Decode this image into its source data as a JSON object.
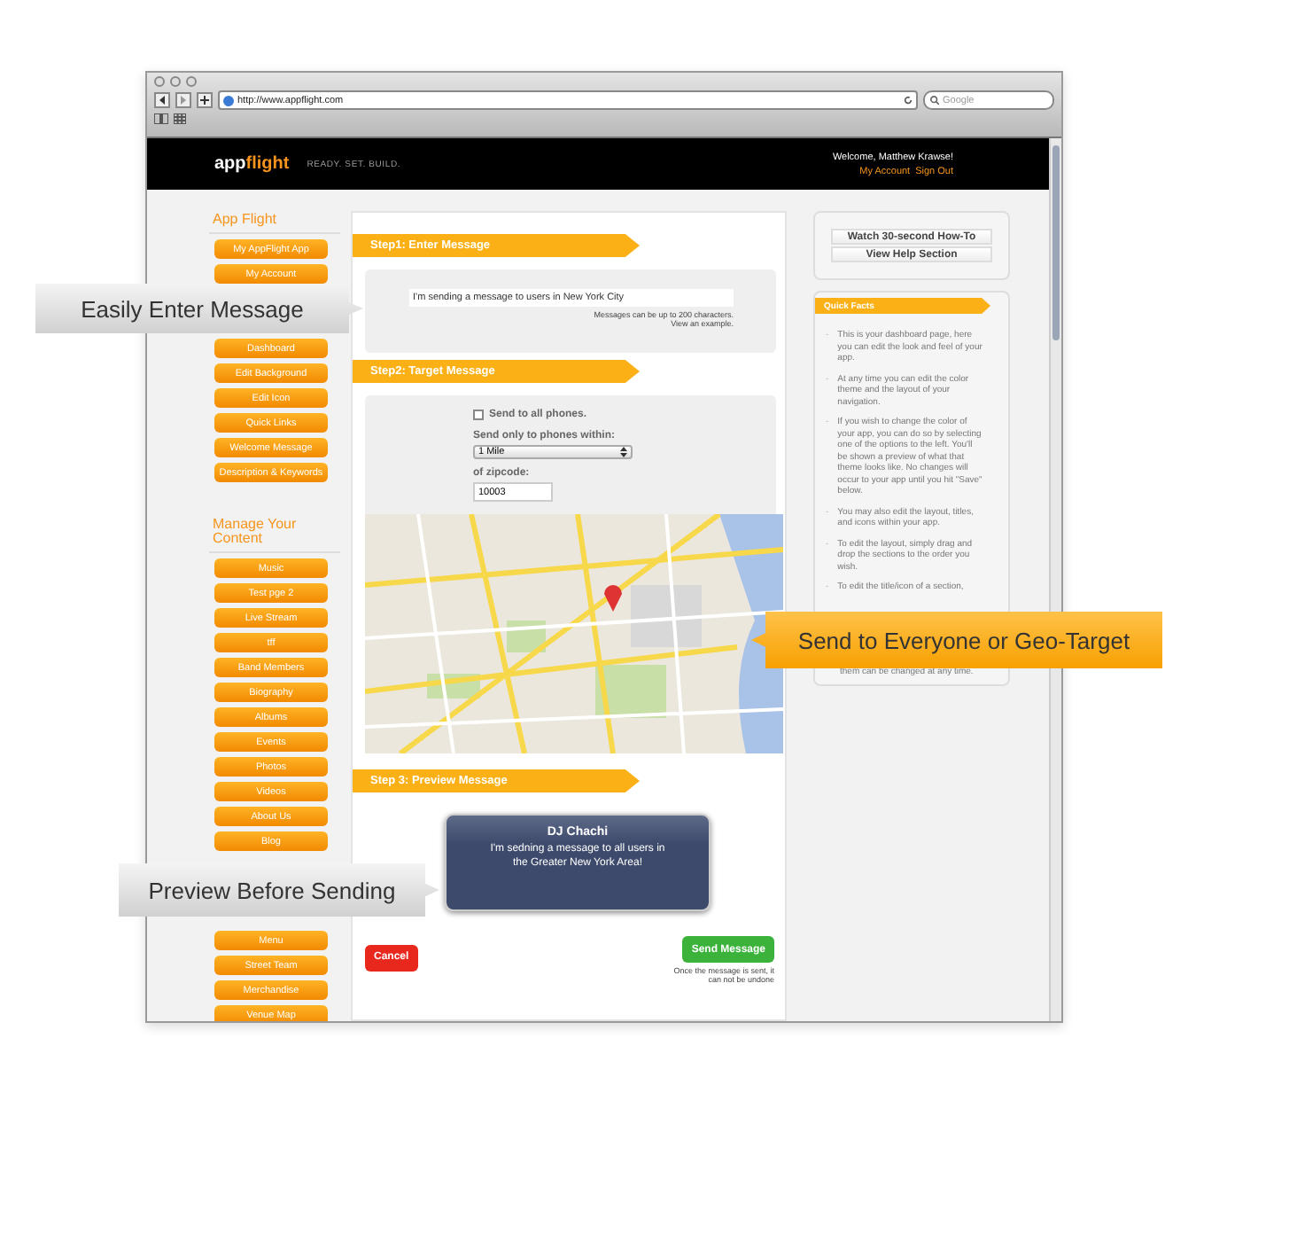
{
  "browser": {
    "url": "http://www.appflight.com",
    "search_placeholder": "Google"
  },
  "header": {
    "logo": [
      {
        "text": "app",
        "kind": "plain"
      },
      {
        "text": "flight",
        "kind": "accent"
      }
    ],
    "tagline": "READY. SET. BUILD.",
    "welcome": "Welcome, Matthew Krawse!",
    "links": [
      "My Account",
      "Sign Out"
    ]
  },
  "sidebar": {
    "sections": [
      {
        "title": "App Flight",
        "items": [
          {
            "kind": "button",
            "label": "My AppFlight App"
          },
          {
            "kind": "button",
            "label": "My Account"
          },
          {
            "kind": "gap"
          },
          {
            "kind": "gap"
          },
          {
            "kind": "button",
            "label": "Dashboard"
          },
          {
            "kind": "button",
            "label": "Edit Background"
          },
          {
            "kind": "button",
            "label": "Edit Icon"
          },
          {
            "kind": "button",
            "label": "Quick Links"
          },
          {
            "kind": "button",
            "label": "Welcome Message"
          },
          {
            "kind": "button",
            "label": "Description & Keywords"
          }
        ]
      },
      {
        "title": "Manage Your Content",
        "items": [
          {
            "kind": "button",
            "label": "Music"
          },
          {
            "kind": "button",
            "label": "Test pge 2"
          },
          {
            "kind": "button",
            "label": "Live Stream"
          },
          {
            "kind": "button",
            "label": "tff"
          },
          {
            "kind": "button",
            "label": "Band Members"
          },
          {
            "kind": "button",
            "label": "Biography"
          },
          {
            "kind": "button",
            "label": "Albums"
          },
          {
            "kind": "button",
            "label": "Events"
          },
          {
            "kind": "button",
            "label": "Photos"
          },
          {
            "kind": "button",
            "label": "Videos"
          },
          {
            "kind": "button",
            "label": "About Us"
          },
          {
            "kind": "button",
            "label": "Blog"
          },
          {
            "kind": "gap"
          },
          {
            "kind": "gap"
          },
          {
            "kind": "gap"
          },
          {
            "kind": "button",
            "label": "Menu"
          },
          {
            "kind": "button",
            "label": "Street Team"
          },
          {
            "kind": "button",
            "label": "Merchandise"
          },
          {
            "kind": "button",
            "label": "Venue Map"
          }
        ]
      }
    ]
  },
  "step1": {
    "title": "Step1: Enter Message",
    "message": "I'm sending a message to users in New York City",
    "hint": "Messages can be up to 200 characters.",
    "link": "View an example."
  },
  "step2": {
    "title": "Step2: Target Message",
    "all_phones": {
      "label": "Send to all phones.",
      "checked": false
    },
    "radius_label": "Send only to phones within:",
    "radius": "1 Mile",
    "zip_label": "of zipcode:",
    "zip": "10003"
  },
  "step3": {
    "title": "Step 3: Preview Message",
    "preview": {
      "sender": "DJ Chachi",
      "message": "I'm sedning a message to all users in the Greater New York Area!"
    }
  },
  "actions": {
    "cancel": "Cancel",
    "send": "Send Message",
    "note": "Once the message is sent, it can not be undone"
  },
  "help": {
    "buttons": [
      "Watch 30-second How-To",
      "View Help Section"
    ]
  },
  "quick_facts": {
    "title": "Quick Facts",
    "bullet": "-",
    "items": [
      "This is your dashboard page, here you can edit the look and feel of your app.",
      "At any time you can edit the color theme and the layout of your navigation.",
      "If you wish to change the color of your app, you can do so by selecting one of the options to the left. You'll be shown a preview of what that theme looks like. No changes will occur to your app until you hit \"Save\" below.",
      "You may also edit the layout, titles, and icons within your app.",
      "To edit the layout, simply drag and drop the sections to the order you wish.",
      "To edit the title/icon of a section,"
    ],
    "continuation": "them can be changed at any time."
  },
  "callouts": [
    {
      "text": "Easily Enter Message",
      "kind": "gray"
    },
    {
      "text": "Send to Everyone or Geo-Target",
      "kind": "orange"
    },
    {
      "text": "Preview Before Sending",
      "kind": "gray"
    }
  ]
}
